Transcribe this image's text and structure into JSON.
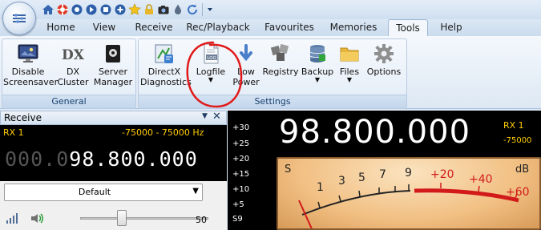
{
  "colors": {
    "accent": "#1f5aa6",
    "rx_yellow": "#ffcc00",
    "annotation": "#e01a1a",
    "meter_red": "#d21a1a"
  },
  "qat": {
    "icons": [
      "home-icon",
      "lifebuoy-icon",
      "record-icon",
      "play-icon",
      "stop-icon",
      "plus-icon",
      "star-icon",
      "lock-icon",
      "camera-icon",
      "waterdrop-icon",
      "refresh-icon",
      "customize-dropdown-icon"
    ]
  },
  "tabs": [
    {
      "label": "Home"
    },
    {
      "label": "View"
    },
    {
      "label": "Receive"
    },
    {
      "label": "Rec/Playback"
    },
    {
      "label": "Favourites"
    },
    {
      "label": "Memories"
    },
    {
      "label": "Tools",
      "active": true
    },
    {
      "label": "Help"
    }
  ],
  "ribbon": {
    "general": {
      "label": "General",
      "buttons": [
        {
          "line1": "Disable",
          "line2": "Screensaver",
          "icon": "monitor-icon"
        },
        {
          "line1": "DX",
          "line2": "Cluster",
          "icon": "dx-icon"
        },
        {
          "line1": "Server",
          "line2": "Manager",
          "icon": "server-icon"
        }
      ]
    },
    "settings": {
      "label": "Settings",
      "buttons": [
        {
          "line1": "DirectX",
          "line2": "Diagnostics",
          "icon": "directx-icon"
        },
        {
          "line1": "Logfile",
          "line2": "",
          "icon": "logfile-icon",
          "badge": "LOG",
          "dropdown": true
        },
        {
          "line1": "Low",
          "line2": "Power",
          "icon": "low-power-icon"
        },
        {
          "line1": "Registry",
          "line2": "",
          "icon": "registry-icon"
        },
        {
          "line1": "Backup",
          "line2": "",
          "icon": "backup-icon",
          "dropdown": true
        },
        {
          "line1": "Files",
          "line2": "",
          "icon": "folder-icon",
          "dropdown": true
        },
        {
          "line1": "Options",
          "line2": "",
          "icon": "gear-icon"
        }
      ]
    }
  },
  "receive_panel": {
    "title": "Receive",
    "rx_label": "RX 1",
    "filter_range": "-75000 - 75000 Hz",
    "freq_dim": "000.0",
    "freq_bright": "98.800.000",
    "mode_value": "Default",
    "volume": "50"
  },
  "meter": {
    "frequency": "98.800.000",
    "rx_label": "RX 1",
    "offset": "-75000",
    "db_scale": [
      "+30",
      "+25",
      "+20",
      "+15",
      "+10",
      "+5",
      "S9"
    ],
    "s_scale": [
      "S",
      "1",
      "3",
      "5",
      "7",
      "9"
    ],
    "over_scale": [
      "+20",
      "+40",
      "+60"
    ],
    "unit": "dB"
  }
}
